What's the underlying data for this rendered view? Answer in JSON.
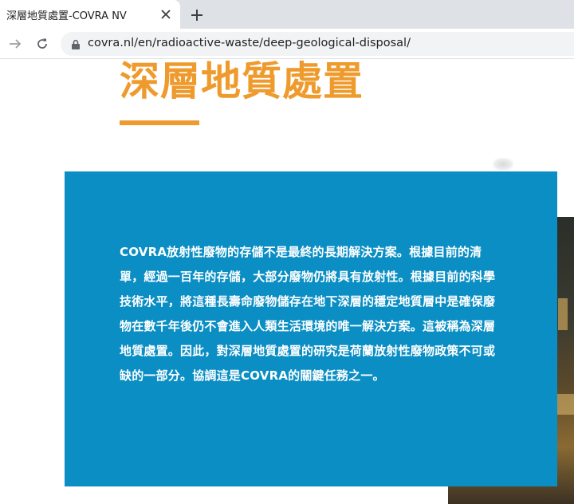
{
  "browser": {
    "tab": {
      "title": "深層地質處置-COVRA NV",
      "close_icon": "close-icon"
    },
    "new_tab_icon": "plus-icon",
    "toolbar": {
      "forward_icon": "arrow-right-icon",
      "reload_icon": "reload-icon",
      "lock_icon": "lock-icon",
      "url": "covra.nl/en/radioactive-waste/deep-geological-disposal/"
    }
  },
  "page": {
    "title": "深層地質處置",
    "body_text": "COVRA放射性廢物的存儲不是最終的長期解決方案。根據目前的清單，經過一百年的存儲，大部分廢物仍將具有放射性。根據目前的科學技術水平，將這種長壽命廢物儲存在地下深層的穩定地質層中是確保廢物在數千年後仍不會進入人類生活環境的唯一解決方案。這被稱為深層地質處置。因此，對深層地質處置的研究是荷蘭放射性廢物政策不可或缺的一部分。協調這是COVRA的關鍵任務之一。"
  },
  "colors": {
    "accent_orange": "#ef9a2c",
    "info_box_blue": "#0a8ec4",
    "tab_strip": "#dee1e6",
    "omnibox": "#f1f3f4"
  }
}
